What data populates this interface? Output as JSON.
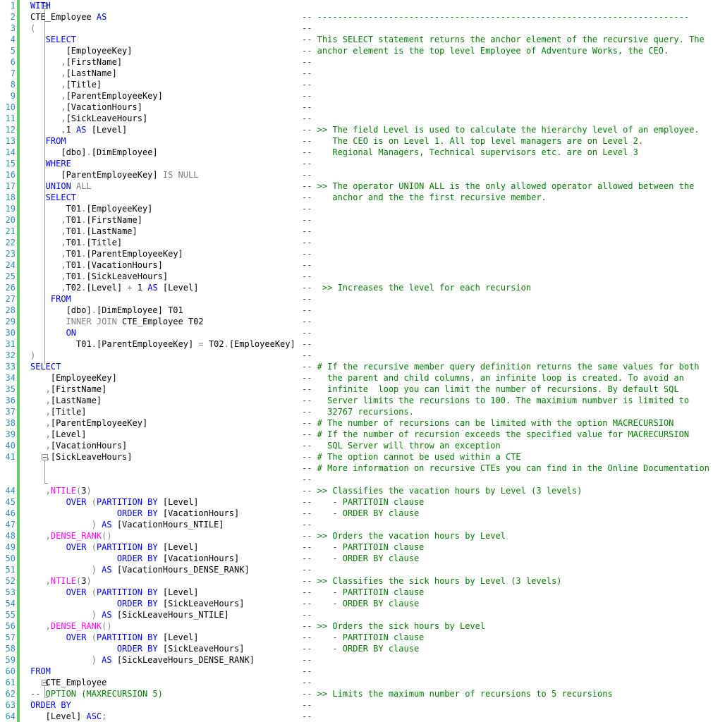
{
  "editor": {
    "lines": [
      {
        "n": "1",
        "code": [
          {
            "t": "WITH",
            "k": "kw"
          }
        ],
        "comment": ""
      },
      {
        "n": "2",
        "code": [
          {
            "t": "CTE_Employee ",
            "k": "tx"
          },
          {
            "t": "AS",
            "k": "kw"
          }
        ],
        "comment": "-- -------------------------------------------------------------------------"
      },
      {
        "n": "3",
        "code": [
          {
            "t": "(",
            "k": "gr"
          }
        ],
        "comment": "--"
      },
      {
        "n": "4",
        "code": [
          {
            "t": "   SELECT",
            "k": "kw"
          }
        ],
        "comment": "-- This SELECT statement returns the anchor element of the recursive query. The"
      },
      {
        "n": "5",
        "code": [
          {
            "t": "       [EmployeeKey]",
            "k": "tx"
          }
        ],
        "comment": "-- anchor element is the top level Employee of Adventure Works, the CEO."
      },
      {
        "n": "6",
        "code": [
          {
            "t": "      ,",
            "k": "gr"
          },
          {
            "t": "[FirstName]",
            "k": "tx"
          }
        ],
        "comment": "--"
      },
      {
        "n": "7",
        "code": [
          {
            "t": "      ,",
            "k": "gr"
          },
          {
            "t": "[LastName]",
            "k": "tx"
          }
        ],
        "comment": "--"
      },
      {
        "n": "8",
        "code": [
          {
            "t": "      ,",
            "k": "gr"
          },
          {
            "t": "[Title]",
            "k": "tx"
          }
        ],
        "comment": "--"
      },
      {
        "n": "9",
        "code": [
          {
            "t": "      ,",
            "k": "gr"
          },
          {
            "t": "[ParentEmployeeKey]",
            "k": "tx"
          }
        ],
        "comment": "--"
      },
      {
        "n": "10",
        "code": [
          {
            "t": "      ,",
            "k": "gr"
          },
          {
            "t": "[VacationHours]",
            "k": "tx"
          }
        ],
        "comment": "--"
      },
      {
        "n": "11",
        "code": [
          {
            "t": "      ,",
            "k": "gr"
          },
          {
            "t": "[SickLeaveHours]",
            "k": "tx"
          }
        ],
        "comment": "--"
      },
      {
        "n": "12",
        "code": [
          {
            "t": "      ,",
            "k": "gr"
          },
          {
            "t": "1 ",
            "k": "tx"
          },
          {
            "t": "AS",
            "k": "kw"
          },
          {
            "t": " [Level]",
            "k": "tx"
          }
        ],
        "comment": "-- >> The field Level is used to calculate the hierarchy level of an employee."
      },
      {
        "n": "13",
        "code": [
          {
            "t": "   FROM",
            "k": "kw"
          }
        ],
        "comment": "--    The CEO is on Level 1. All top level managers are on Level 2."
      },
      {
        "n": "14",
        "code": [
          {
            "t": "      [dbo]",
            "k": "tx"
          },
          {
            "t": ".",
            "k": "gr"
          },
          {
            "t": "[DimEmployee]",
            "k": "tx"
          }
        ],
        "comment": "--    Regional Managers, Technical supervisors etc. are on Level 3"
      },
      {
        "n": "15",
        "code": [
          {
            "t": "   WHERE",
            "k": "kw"
          }
        ],
        "comment": "--"
      },
      {
        "n": "16",
        "code": [
          {
            "t": "      [ParentEmployeeKey] ",
            "k": "tx"
          },
          {
            "t": "IS NULL",
            "k": "gr"
          }
        ],
        "comment": "--"
      },
      {
        "n": "17",
        "code": [
          {
            "t": "   UNION",
            "k": "kw"
          },
          {
            "t": " ALL",
            "k": "gr"
          }
        ],
        "comment": "-- >> The operator UNION ALL is the only allowed operator allowed between the"
      },
      {
        "n": "18",
        "code": [
          {
            "t": "   SELECT",
            "k": "kw"
          }
        ],
        "comment": "--    anchor and the the first recursive member."
      },
      {
        "n": "19",
        "code": [
          {
            "t": "       T01",
            "k": "tx"
          },
          {
            "t": ".",
            "k": "gr"
          },
          {
            "t": "[EmployeeKey]",
            "k": "tx"
          }
        ],
        "comment": "--"
      },
      {
        "n": "20",
        "code": [
          {
            "t": "      ,",
            "k": "gr"
          },
          {
            "t": "T01",
            "k": "tx"
          },
          {
            "t": ".",
            "k": "gr"
          },
          {
            "t": "[FirstName]",
            "k": "tx"
          }
        ],
        "comment": "--"
      },
      {
        "n": "21",
        "code": [
          {
            "t": "      ,",
            "k": "gr"
          },
          {
            "t": "T01",
            "k": "tx"
          },
          {
            "t": ".",
            "k": "gr"
          },
          {
            "t": "[LastName]",
            "k": "tx"
          }
        ],
        "comment": "--"
      },
      {
        "n": "22",
        "code": [
          {
            "t": "      ,",
            "k": "gr"
          },
          {
            "t": "T01",
            "k": "tx"
          },
          {
            "t": ".",
            "k": "gr"
          },
          {
            "t": "[Title]",
            "k": "tx"
          }
        ],
        "comment": "--"
      },
      {
        "n": "23",
        "code": [
          {
            "t": "      ,",
            "k": "gr"
          },
          {
            "t": "T01",
            "k": "tx"
          },
          {
            "t": ".",
            "k": "gr"
          },
          {
            "t": "[ParentEmployeeKey]",
            "k": "tx"
          }
        ],
        "comment": "--"
      },
      {
        "n": "24",
        "code": [
          {
            "t": "      ,",
            "k": "gr"
          },
          {
            "t": "T01",
            "k": "tx"
          },
          {
            "t": ".",
            "k": "gr"
          },
          {
            "t": "[VacationHours]",
            "k": "tx"
          }
        ],
        "comment": "--"
      },
      {
        "n": "25",
        "code": [
          {
            "t": "      ,",
            "k": "gr"
          },
          {
            "t": "T01",
            "k": "tx"
          },
          {
            "t": ".",
            "k": "gr"
          },
          {
            "t": "[SickLeaveHours]",
            "k": "tx"
          }
        ],
        "comment": "--"
      },
      {
        "n": "26",
        "code": [
          {
            "t": "      ,",
            "k": "gr"
          },
          {
            "t": "T02",
            "k": "tx"
          },
          {
            "t": ".",
            "k": "gr"
          },
          {
            "t": "[Level] ",
            "k": "tx"
          },
          {
            "t": "+",
            "k": "gr"
          },
          {
            "t": " 1 ",
            "k": "tx"
          },
          {
            "t": "AS",
            "k": "kw"
          },
          {
            "t": " [Level]",
            "k": "tx"
          }
        ],
        "comment": "--  >> Increases the level for each recursion"
      },
      {
        "n": "27",
        "code": [
          {
            "t": "    FROM",
            "k": "kw"
          }
        ],
        "comment": "--"
      },
      {
        "n": "28",
        "code": [
          {
            "t": "       [dbo]",
            "k": "tx"
          },
          {
            "t": ".",
            "k": "gr"
          },
          {
            "t": "[DimEmployee] T01",
            "k": "tx"
          }
        ],
        "comment": "--"
      },
      {
        "n": "29",
        "code": [
          {
            "t": "       INNER JOIN",
            "k": "gr"
          },
          {
            "t": " CTE_Employee T02",
            "k": "tx"
          }
        ],
        "comment": "--"
      },
      {
        "n": "30",
        "code": [
          {
            "t": "       ON",
            "k": "kw"
          }
        ],
        "comment": "--"
      },
      {
        "n": "31",
        "code": [
          {
            "t": "         T01",
            "k": "tx"
          },
          {
            "t": ".",
            "k": "gr"
          },
          {
            "t": "[ParentEmployeeKey] ",
            "k": "tx"
          },
          {
            "t": "=",
            "k": "gr"
          },
          {
            "t": " T02",
            "k": "tx"
          },
          {
            "t": ".",
            "k": "gr"
          },
          {
            "t": "[EmployeeKey]",
            "k": "tx"
          }
        ],
        "comment": "--"
      },
      {
        "n": "32",
        "code": [
          {
            "t": ")",
            "k": "gr"
          }
        ],
        "comment": "--"
      },
      {
        "n": "33",
        "code": [
          {
            "t": "SELECT",
            "k": "kw"
          }
        ],
        "comment": "-- # If the recursive member query definition returns the same values for both"
      },
      {
        "n": "34",
        "code": [
          {
            "t": "    [EmployeeKey]",
            "k": "tx"
          }
        ],
        "comment": "--   the parent and child columns, an infinite loop is created. To avoid an"
      },
      {
        "n": "35",
        "code": [
          {
            "t": "   ,",
            "k": "gr"
          },
          {
            "t": "[FirstName]",
            "k": "tx"
          }
        ],
        "comment": "--   infinite  loop you can limit the number of recursions. By default SQL"
      },
      {
        "n": "36",
        "code": [
          {
            "t": "   ,",
            "k": "gr"
          },
          {
            "t": "[LastName]",
            "k": "tx"
          }
        ],
        "comment": "--   Server limits the recursions to 100. The maximium numbver is limited to"
      },
      {
        "n": "37",
        "code": [
          {
            "t": "   ,",
            "k": "gr"
          },
          {
            "t": "[Title]",
            "k": "tx"
          }
        ],
        "comment": "--   32767 recursions."
      },
      {
        "n": "38",
        "code": [
          {
            "t": "   ,",
            "k": "gr"
          },
          {
            "t": "[ParentEmployeeKey]",
            "k": "tx"
          }
        ],
        "comment": "-- # The number of recursions can be limited with the option MACRECURSION"
      },
      {
        "n": "39",
        "code": [
          {
            "t": "   ,",
            "k": "gr"
          },
          {
            "t": "[Level]",
            "k": "tx"
          }
        ],
        "comment": "-- # If the number of recursion exceeds the specified value for MACRECURSION"
      },
      {
        "n": "40",
        "code": [
          {
            "t": "   ,",
            "k": "gr"
          },
          {
            "t": "[VacationHours]",
            "k": "tx"
          }
        ],
        "comment": "--   SQL Server will throw an exception"
      },
      {
        "n": "41",
        "code": [
          {
            "t": "   ,",
            "k": "gr"
          },
          {
            "t": "[SickLeaveHours]",
            "k": "tx"
          }
        ],
        "comment": "-- # The option cannot be used within a CTE"
      },
      {
        "n": "",
        "code": [],
        "comment": "-- # More information on recursive CTEs you can find in the Online Documentation"
      },
      {
        "n": "",
        "code": [],
        "comment": "--"
      },
      {
        "n": "44",
        "code": [
          {
            "t": "   ,",
            "k": "gr"
          },
          {
            "t": "NTILE",
            "k": "fn"
          },
          {
            "t": "(",
            "k": "gr"
          },
          {
            "t": "3",
            "k": "tx"
          },
          {
            "t": ")",
            "k": "gr"
          }
        ],
        "comment": "-- >> Classifies the vacation hours by Level (3 levels)"
      },
      {
        "n": "45",
        "code": [
          {
            "t": "       OVER ",
            "k": "kw"
          },
          {
            "t": "(",
            "k": "gr"
          },
          {
            "t": "PARTITION BY",
            "k": "kw"
          },
          {
            "t": " [Level]",
            "k": "tx"
          }
        ],
        "comment": "--    - PARTITOIN clause"
      },
      {
        "n": "46",
        "code": [
          {
            "t": "                 ORDER BY",
            "k": "kw"
          },
          {
            "t": " [VacationHours]",
            "k": "tx"
          }
        ],
        "comment": "--    - ORDER BY clause"
      },
      {
        "n": "47",
        "code": [
          {
            "t": "            ) ",
            "k": "gr"
          },
          {
            "t": "AS",
            "k": "kw"
          },
          {
            "t": " [VacationHours_NTILE]",
            "k": "tx"
          }
        ],
        "comment": "--"
      },
      {
        "n": "48",
        "code": [
          {
            "t": "   ,",
            "k": "gr"
          },
          {
            "t": "DENSE_RANK",
            "k": "fn"
          },
          {
            "t": "()",
            "k": "gr"
          }
        ],
        "comment": "-- >> Orders the vacation hours by Level"
      },
      {
        "n": "49",
        "code": [
          {
            "t": "       OVER ",
            "k": "kw"
          },
          {
            "t": "(",
            "k": "gr"
          },
          {
            "t": "PARTITION BY",
            "k": "kw"
          },
          {
            "t": " [Level]",
            "k": "tx"
          }
        ],
        "comment": "--    - PARTITOIN clause"
      },
      {
        "n": "50",
        "code": [
          {
            "t": "                 ORDER BY",
            "k": "kw"
          },
          {
            "t": " [VacationHours]",
            "k": "tx"
          }
        ],
        "comment": "--    - ORDER BY clause"
      },
      {
        "n": "51",
        "code": [
          {
            "t": "            ) ",
            "k": "gr"
          },
          {
            "t": "AS",
            "k": "kw"
          },
          {
            "t": " [VacationHours_DENSE_RANK]",
            "k": "tx"
          }
        ],
        "comment": "--"
      },
      {
        "n": "52",
        "code": [
          {
            "t": "   ,",
            "k": "gr"
          },
          {
            "t": "NTILE",
            "k": "fn"
          },
          {
            "t": "(",
            "k": "gr"
          },
          {
            "t": "3",
            "k": "tx"
          },
          {
            "t": ")",
            "k": "gr"
          }
        ],
        "comment": "-- >> Classifies the sick hours by Level (3 levels)"
      },
      {
        "n": "53",
        "code": [
          {
            "t": "       OVER ",
            "k": "kw"
          },
          {
            "t": "(",
            "k": "gr"
          },
          {
            "t": "PARTITION BY",
            "k": "kw"
          },
          {
            "t": " [Level]",
            "k": "tx"
          }
        ],
        "comment": "--    - PARTITOIN clause"
      },
      {
        "n": "54",
        "code": [
          {
            "t": "                 ORDER BY",
            "k": "kw"
          },
          {
            "t": " [SickLeaveHours]",
            "k": "tx"
          }
        ],
        "comment": "--    - ORDER BY clause"
      },
      {
        "n": "55",
        "code": [
          {
            "t": "            ) ",
            "k": "gr"
          },
          {
            "t": "AS",
            "k": "kw"
          },
          {
            "t": " [SickLeaveHours_NTILE]",
            "k": "tx"
          }
        ],
        "comment": "--"
      },
      {
        "n": "56",
        "code": [
          {
            "t": "   ,",
            "k": "gr"
          },
          {
            "t": "DENSE_RANK",
            "k": "fn"
          },
          {
            "t": "()",
            "k": "gr"
          }
        ],
        "comment": "-- >> Orders the sick hours by Level"
      },
      {
        "n": "57",
        "code": [
          {
            "t": "       OVER ",
            "k": "kw"
          },
          {
            "t": "(",
            "k": "gr"
          },
          {
            "t": "PARTITION BY",
            "k": "kw"
          },
          {
            "t": " [Level]",
            "k": "tx"
          }
        ],
        "comment": "--    - PARTITOIN clause"
      },
      {
        "n": "58",
        "code": [
          {
            "t": "                 ORDER BY",
            "k": "kw"
          },
          {
            "t": " [SickLeaveHours]",
            "k": "tx"
          }
        ],
        "comment": "--    - ORDER BY clause"
      },
      {
        "n": "59",
        "code": [
          {
            "t": "            ) ",
            "k": "gr"
          },
          {
            "t": "AS",
            "k": "kw"
          },
          {
            "t": " [SickLeaveHours_DENSE_RANK]",
            "k": "tx"
          }
        ],
        "comment": "--"
      },
      {
        "n": "60",
        "code": [
          {
            "t": "FROM",
            "k": "kw"
          }
        ],
        "comment": "--"
      },
      {
        "n": "61",
        "code": [
          {
            "t": "   CTE_Employee",
            "k": "tx"
          }
        ],
        "comment": "--"
      },
      {
        "n": "62",
        "code": [
          {
            "t": "-- OPTION (MAXRECURSION 5)",
            "k": "c-green"
          }
        ],
        "comment": "-- >> Limits the maximum number of recursions to 5 recursions"
      },
      {
        "n": "63",
        "code": [
          {
            "t": "ORDER BY",
            "k": "kw"
          }
        ],
        "comment": "--"
      },
      {
        "n": "64",
        "code": [
          {
            "t": "   [Level] ",
            "k": "tx"
          },
          {
            "t": "ASC",
            "k": "kw"
          },
          {
            "t": ";",
            "k": "gr"
          }
        ],
        "comment": "--"
      }
    ]
  },
  "colors": {
    "keyword": "#0000ff",
    "function": "#ff00ff",
    "comment": "#008000",
    "operator": "#808080",
    "line_number": "#2b91af",
    "change_bar": "#6cc86c"
  }
}
